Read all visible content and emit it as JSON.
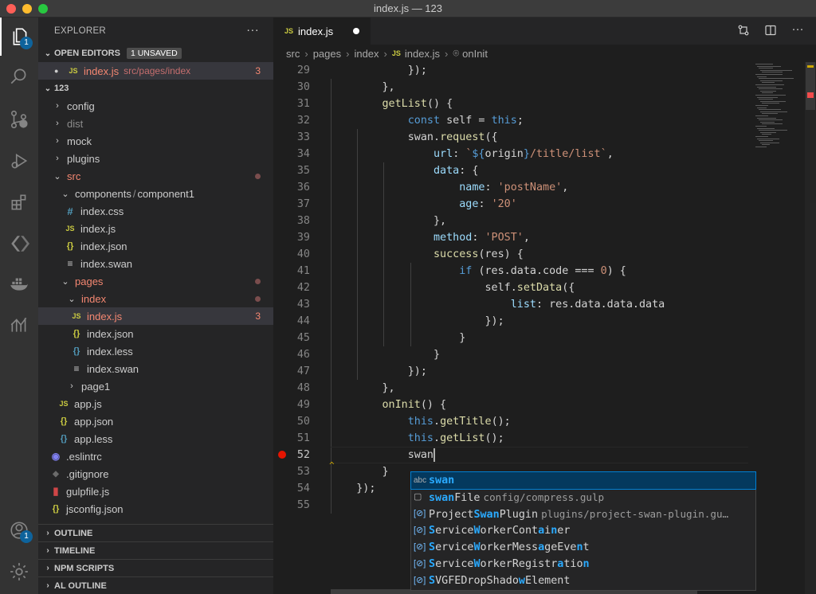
{
  "window": {
    "title": "index.js — 123"
  },
  "activity_bar": {
    "explorer_badge": "1",
    "accounts_badge": "1",
    "items": [
      "files-icon",
      "search-icon",
      "source-control-icon",
      "run-debug-icon",
      "extensions-icon",
      "remote-icon",
      "docker-icon",
      "analytics-icon"
    ]
  },
  "explorer": {
    "header": "EXPLORER",
    "more": "···",
    "open_editors": {
      "title": "OPEN EDITORS",
      "badge": "1 UNSAVED",
      "items": [
        {
          "name": "index.js",
          "path": "src/pages/index",
          "problems": "3"
        }
      ]
    },
    "root": "123",
    "tree": {
      "config": "config",
      "dist": "dist",
      "mock": "mock",
      "plugins": "plugins",
      "src": "src",
      "components": "components",
      "component1": "component1",
      "path_sep": "/",
      "comp_index_css": "index.css",
      "comp_index_js": "index.js",
      "comp_index_json": "index.json",
      "comp_index_swan": "index.swan",
      "pages": "pages",
      "index_folder": "index",
      "index_js": "index.js",
      "index_js_problems": "3",
      "index_json": "index.json",
      "index_less": "index.less",
      "index_swan": "index.swan",
      "page1": "page1",
      "app_js": "app.js",
      "app_json": "app.json",
      "app_less": "app.less",
      "eslintrc": ".eslintrc",
      "gitignore": ".gitignore",
      "gulpfile": "gulpfile.js",
      "jsconfig": "jsconfig.json"
    },
    "bottom_sections": [
      "OUTLINE",
      "TIMELINE",
      "NPM SCRIPTS",
      "AL OUTLINE"
    ]
  },
  "editor": {
    "tab": {
      "label": "index.js",
      "icon": "JS"
    },
    "breadcrumbs": [
      "src",
      "pages",
      "index",
      "index.js",
      "onInit"
    ],
    "gutter_marker": "^",
    "code_lines": [
      {
        "n": "29",
        "tokens": [
          [
            "",
            "            });"
          ]
        ]
      },
      {
        "n": "30",
        "tokens": [
          [
            "",
            "        },"
          ]
        ]
      },
      {
        "n": "31",
        "tokens": [
          [
            "f",
            "        getList"
          ],
          [
            "",
            "() {"
          ]
        ]
      },
      {
        "n": "32",
        "tokens": [
          [
            "k",
            "            const "
          ],
          [
            "",
            "self = "
          ],
          [
            "k",
            "this"
          ],
          [
            "",
            ";"
          ]
        ]
      },
      {
        "n": "33",
        "tokens": [
          [
            "",
            "            swan."
          ],
          [
            "f",
            "request"
          ],
          [
            "",
            "({"
          ]
        ]
      },
      {
        "n": "34",
        "tokens": [
          [
            "p",
            "                url"
          ],
          [
            "",
            ": "
          ],
          [
            "s",
            "`"
          ],
          [
            "tpl",
            "${"
          ],
          [
            "",
            "origin"
          ],
          [
            "tpl",
            "}"
          ],
          [
            "s",
            "/title/list`"
          ],
          [
            "",
            ","
          ]
        ]
      },
      {
        "n": "35",
        "tokens": [
          [
            "p",
            "                data"
          ],
          [
            "",
            ": {"
          ]
        ]
      },
      {
        "n": "36",
        "tokens": [
          [
            "p",
            "                    name"
          ],
          [
            "",
            ": "
          ],
          [
            "s",
            "'postName'"
          ],
          [
            "",
            ","
          ]
        ]
      },
      {
        "n": "37",
        "tokens": [
          [
            "p",
            "                    age"
          ],
          [
            "",
            ": "
          ],
          [
            "s",
            "'20'"
          ]
        ]
      },
      {
        "n": "38",
        "tokens": [
          [
            "",
            "                },"
          ]
        ]
      },
      {
        "n": "39",
        "tokens": [
          [
            "p",
            "                method"
          ],
          [
            "",
            ": "
          ],
          [
            "s",
            "'POST'"
          ],
          [
            "",
            ","
          ]
        ]
      },
      {
        "n": "40",
        "tokens": [
          [
            "f",
            "                success"
          ],
          [
            "",
            "(res) {"
          ]
        ]
      },
      {
        "n": "41",
        "tokens": [
          [
            "k",
            "                    if "
          ],
          [
            "",
            "(res.data.code === "
          ],
          [
            "s",
            "0"
          ],
          [
            "",
            ") {"
          ]
        ]
      },
      {
        "n": "42",
        "tokens": [
          [
            "",
            "                        self."
          ],
          [
            "f",
            "setData"
          ],
          [
            "",
            "({"
          ]
        ]
      },
      {
        "n": "43",
        "tokens": [
          [
            "p",
            "                            list"
          ],
          [
            "",
            ": res.data.data.data"
          ]
        ]
      },
      {
        "n": "44",
        "tokens": [
          [
            "",
            "                        });"
          ]
        ]
      },
      {
        "n": "45",
        "tokens": [
          [
            "",
            "                    }"
          ]
        ]
      },
      {
        "n": "46",
        "tokens": [
          [
            "",
            "                }"
          ]
        ]
      },
      {
        "n": "47",
        "tokens": [
          [
            "",
            "            });"
          ]
        ]
      },
      {
        "n": "48",
        "tokens": [
          [
            "",
            "        },"
          ]
        ]
      },
      {
        "n": "49",
        "tokens": [
          [
            "f",
            "        onInit"
          ],
          [
            "",
            "() {"
          ]
        ]
      },
      {
        "n": "50",
        "tokens": [
          [
            "k",
            "            this"
          ],
          [
            "",
            "."
          ],
          [
            "f",
            "getTitle"
          ],
          [
            "",
            "();"
          ]
        ]
      },
      {
        "n": "51",
        "tokens": [
          [
            "k",
            "            this"
          ],
          [
            "",
            "."
          ],
          [
            "f",
            "getList"
          ],
          [
            "",
            "();"
          ]
        ]
      },
      {
        "n": "52",
        "tokens": [
          [
            "",
            "            swan"
          ]
        ]
      },
      {
        "n": "53",
        "tokens": [
          [
            "",
            "        }"
          ]
        ]
      },
      {
        "n": "54",
        "tokens": [
          [
            "",
            "    });"
          ]
        ]
      },
      {
        "n": "55",
        "tokens": [
          [
            "",
            ""
          ]
        ]
      }
    ],
    "suggestions": [
      {
        "kind": "abc",
        "label": "swan",
        "match": "swan",
        "detail": ""
      },
      {
        "kind": "file",
        "label": "swanFile",
        "match": "swan",
        "detail": "config/compress.gulp"
      },
      {
        "kind": "var",
        "label": "ProjectSwanPlugin",
        "match": "Swan",
        "detail": "plugins/project-swan-plugin.gu…"
      },
      {
        "kind": "var",
        "label": "ServiceWorkerContainer",
        "match": "",
        "detail": ""
      },
      {
        "kind": "var",
        "label": "ServiceWorkerMessageEvent",
        "match": "",
        "detail": ""
      },
      {
        "kind": "var",
        "label": "ServiceWorkerRegistration",
        "match": "",
        "detail": ""
      },
      {
        "kind": "var",
        "label": "SVGFEDropShadowElement",
        "match": "",
        "detail": ""
      }
    ]
  },
  "colors": {
    "accent": "#007fd4",
    "error": "#f48771",
    "breakpoint": "#e51400",
    "warning": "#cca700"
  }
}
